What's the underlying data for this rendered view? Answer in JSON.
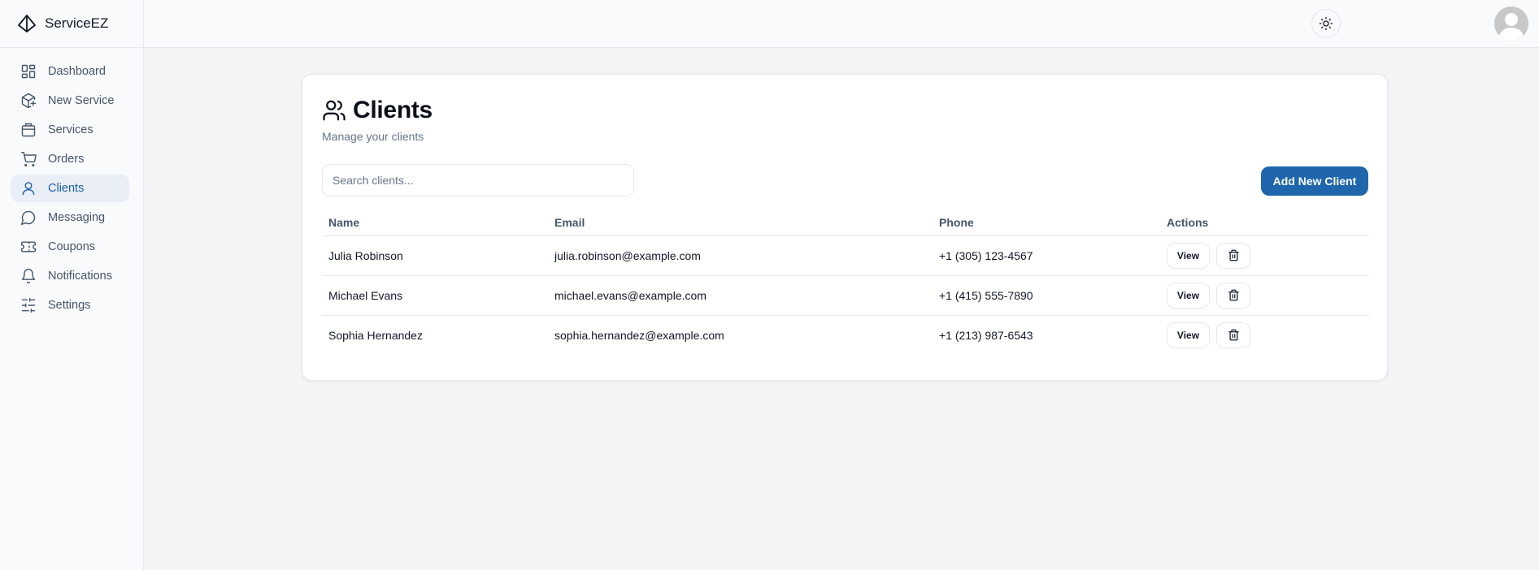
{
  "app": {
    "name": "ServiceEZ"
  },
  "sidebar": {
    "items": [
      {
        "label": "Dashboard",
        "icon": "dashboard-icon"
      },
      {
        "label": "New Service",
        "icon": "package-plus-icon"
      },
      {
        "label": "Services",
        "icon": "box-icon"
      },
      {
        "label": "Orders",
        "icon": "cart-icon"
      },
      {
        "label": "Clients",
        "icon": "user-icon",
        "active": true
      },
      {
        "label": "Messaging",
        "icon": "message-icon"
      },
      {
        "label": "Coupons",
        "icon": "ticket-icon"
      },
      {
        "label": "Notifications",
        "icon": "bell-icon"
      },
      {
        "label": "Settings",
        "icon": "sliders-icon"
      }
    ]
  },
  "page": {
    "title": "Clients",
    "subtitle": "Manage your clients",
    "search_placeholder": "Search clients...",
    "add_button": "Add New Client"
  },
  "table": {
    "headers": [
      "Name",
      "Email",
      "Phone",
      "Actions"
    ],
    "rows": [
      {
        "name": "Julia Robinson",
        "email": "julia.robinson@example.com",
        "phone": "+1 (305) 123-4567"
      },
      {
        "name": "Michael Evans",
        "email": "michael.evans@example.com",
        "phone": "+1 (415) 555-7890"
      },
      {
        "name": "Sophia Hernandez",
        "email": "sophia.hernandez@example.com",
        "phone": "+1 (213) 987-6543"
      }
    ],
    "view_label": "View"
  },
  "colors": {
    "accent": "#1f66ad",
    "active_nav_bg": "#eaeff7",
    "active_nav_text": "#1e5fa8"
  }
}
